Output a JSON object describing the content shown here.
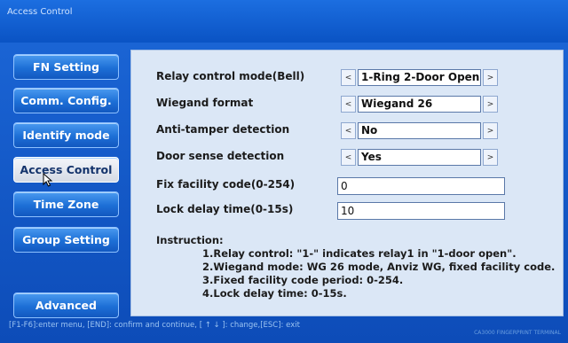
{
  "window": {
    "title": "Access Control"
  },
  "sidebar": {
    "items": [
      {
        "label": "FN Setting",
        "active": false
      },
      {
        "label": "Comm. Config.",
        "active": false
      },
      {
        "label": "Identify mode",
        "active": false
      },
      {
        "label": "Access Control",
        "active": true
      },
      {
        "label": "Time Zone",
        "active": false
      },
      {
        "label": "Group Setting",
        "active": false
      },
      {
        "label": "Advanced",
        "active": false
      }
    ]
  },
  "settings": {
    "relay_mode": {
      "label": "Relay control mode(Bell)",
      "value": "1-Ring 2-Door Open"
    },
    "wiegand": {
      "label": "Wiegand format",
      "value": "Wiegand 26"
    },
    "anti_tamper": {
      "label": "Anti-tamper detection",
      "value": "No"
    },
    "door_sense": {
      "label": "Door sense detection",
      "value": "Yes"
    },
    "facility_code": {
      "label": "Fix facility code(0-254)",
      "value": "0"
    },
    "lock_delay": {
      "label": "Lock delay time(0-15s)",
      "value": "10"
    },
    "arrow_prev": "<",
    "arrow_next": ">"
  },
  "instruction": {
    "heading": "Instruction:",
    "lines": [
      "1.Relay control: \"1-\" indicates relay1 in \"1-door open\".",
      "2.Wiegand mode: WG 26 mode, Anviz WG, fixed facility code.",
      "3.Fixed facility code period: 0-254.",
      "4.Lock delay time: 0-15s."
    ]
  },
  "status_bar": {
    "text": "[F1-F6]:enter menu, [END]: confirm and continue, [ ↑ ↓ ]: change,[ESC]: exit"
  },
  "brand": {
    "text": "CA3000 FINGERPRINT TERMINAL"
  },
  "colors": {
    "background": "#0a4fb0",
    "panel": "#dbe7f6",
    "button": "#1d6fd6",
    "active_button": "#e6eaf0"
  },
  "icons": {
    "cursor": "mouse-pointer-icon"
  }
}
